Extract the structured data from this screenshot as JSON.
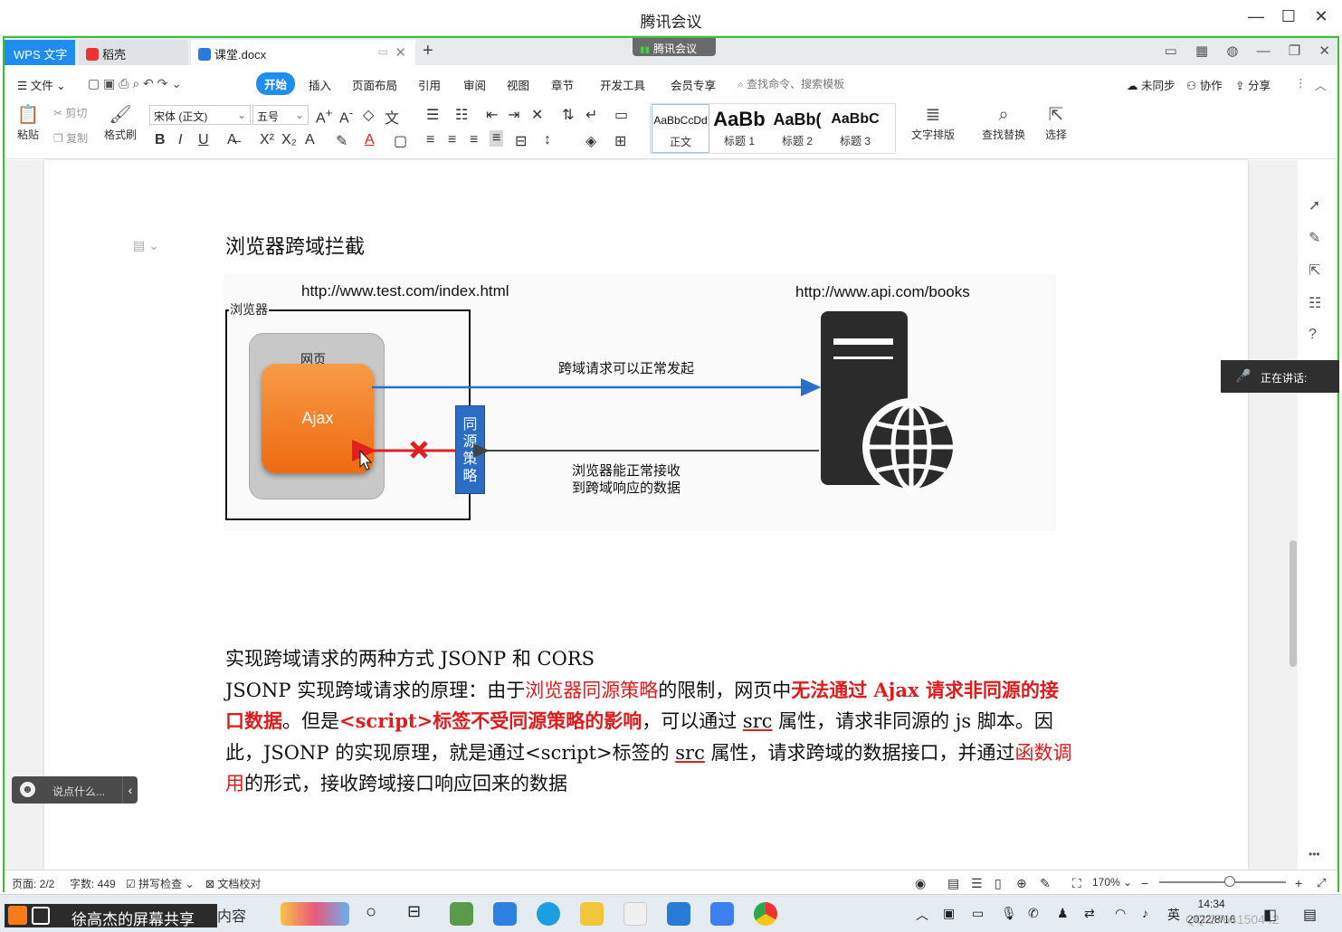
{
  "window": {
    "title": "腾讯会议",
    "controls": [
      "—",
      "☐",
      "✕"
    ]
  },
  "wps": {
    "app_tab": "WPS 文字",
    "docer_tab": "稻壳",
    "doc_tab": "课堂.docx",
    "meeting_badge": "腾讯会议",
    "menu": {
      "file": "文件",
      "items": [
        "开始",
        "插入",
        "页面布局",
        "引用",
        "审阅",
        "视图",
        "章节",
        "开发工具",
        "会员专享"
      ],
      "search": "查找命令、搜索模板",
      "sync": "未同步",
      "collab": "协作",
      "share": "分享"
    },
    "ribbon": {
      "paste": "粘贴",
      "cut": "剪切",
      "copy": "复制",
      "format_painter": "格式刷",
      "font_name": "宋体 (正文)",
      "font_size": "五号",
      "styles": [
        {
          "preview": "AaBbCcDd",
          "label": "正文"
        },
        {
          "preview": "AaBb",
          "label": "标题 1"
        },
        {
          "preview": "AaBb(",
          "label": "标题 2"
        },
        {
          "preview": "AaBbC",
          "label": "标题 3"
        }
      ],
      "text_layout": "文字排版",
      "find_replace": "查找替换",
      "select": "选择"
    }
  },
  "document": {
    "heading": "浏览器跨域拦截",
    "diagram": {
      "url_left": "http://www.test.com/index.html",
      "url_right": "http://www.api.com/books",
      "browser": "浏览器",
      "webpage": "网页",
      "ajax": "Ajax",
      "same_origin": [
        "同",
        "源",
        "策",
        "略"
      ],
      "request_ok": "跨域请求可以正常发起",
      "response_recv_1": "浏览器能正常接收",
      "response_recv_2": "到跨域响应的数据"
    },
    "p1": "实现跨域请求的两种方式 JSONP 和 CORS",
    "p2": {
      "a": "JSONP 实现跨域请求的原理：由于",
      "b": "浏览器同源策略",
      "c": "的限制，网页中",
      "d": "无法通过 Ajax 请求非同源的接口数据",
      "e": "。但是",
      "f": "<script>标签不受同源策略的影响",
      "g": "，可以通过 ",
      "h": "src",
      "i": " 属性，请求非同源的 js 脚本。因此，JSONP 的实现原理，就是通过<script>标签的 ",
      "j": "src",
      "k": " 属性，请求跨域的数据接口，并通过",
      "l": "函数调用",
      "m": "的形式，接收跨域接口响应回来的数据"
    }
  },
  "overlay": {
    "speaking": "正在讲话:",
    "chat_placeholder": "说点什么..."
  },
  "status": {
    "page": "页面: 2/2",
    "words": "字数: 449",
    "spell": "拼写检查",
    "proof": "文档校对",
    "zoom": "170%"
  },
  "taskbar": {
    "share_banner": "徐高杰的屏幕共享",
    "ghost_text": "内容",
    "ime": "英",
    "time": "14:34",
    "date": "2022/8/16",
    "watermark": "QQ:2764150442"
  }
}
